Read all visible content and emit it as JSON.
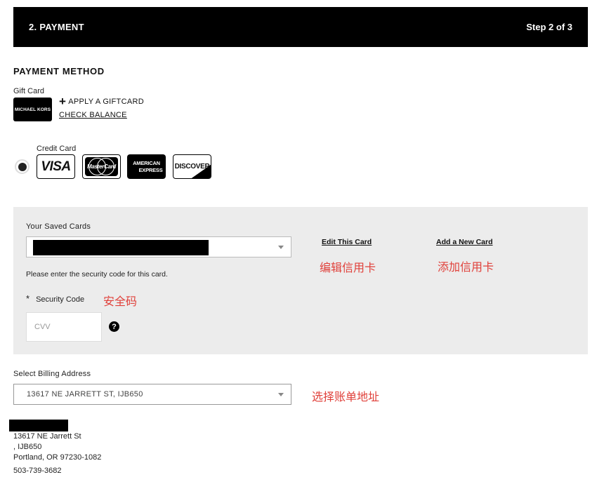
{
  "header": {
    "title": "2. PAYMENT",
    "step": "Step 2 of 3"
  },
  "payment_method": {
    "title": "PAYMENT METHOD",
    "gift_card": {
      "label": "Gift Card",
      "brand": "MICHAEL KORS",
      "apply_label": "APPLY A GIFTCARD",
      "check_balance_label": "CHECK BALANCE"
    },
    "credit_card": {
      "label": "Credit Card",
      "selected": true,
      "logos": {
        "visa": "VISA",
        "mastercard": "MasterCard",
        "amex_line1": "AMERICAN",
        "amex_line2": "EXPRESS",
        "discover": "DISCOVER"
      }
    }
  },
  "saved_cards": {
    "label": "Your Saved Cards",
    "edit_label": "Edit This Card",
    "add_label": "Add a New Card",
    "edit_note": "编辑信用卡",
    "add_note": "添加信用卡",
    "security_message": "Please enter the security code for this card.",
    "security_required_mark": "*",
    "security_label": "Security Code",
    "security_note": "安全码",
    "cvv_placeholder": "CVV",
    "help_glyph": "?"
  },
  "billing": {
    "label": "Select Billing Address",
    "selected_value": "13617 NE JARRETT ST, IJB650",
    "note": "选择账单地址",
    "address_lines": [
      "13617 NE Jarrett St",
      ", IJB650",
      "Portland, OR 97230-1082",
      "503-739-3682"
    ]
  },
  "icons": {
    "apply": "plus-icon",
    "dropdown": "chevron-down-icon",
    "help": "question-circle-icon"
  },
  "colors": {
    "header_bg": "#000000",
    "panel_bg": "#ececec",
    "annotation": "#e0403a"
  }
}
